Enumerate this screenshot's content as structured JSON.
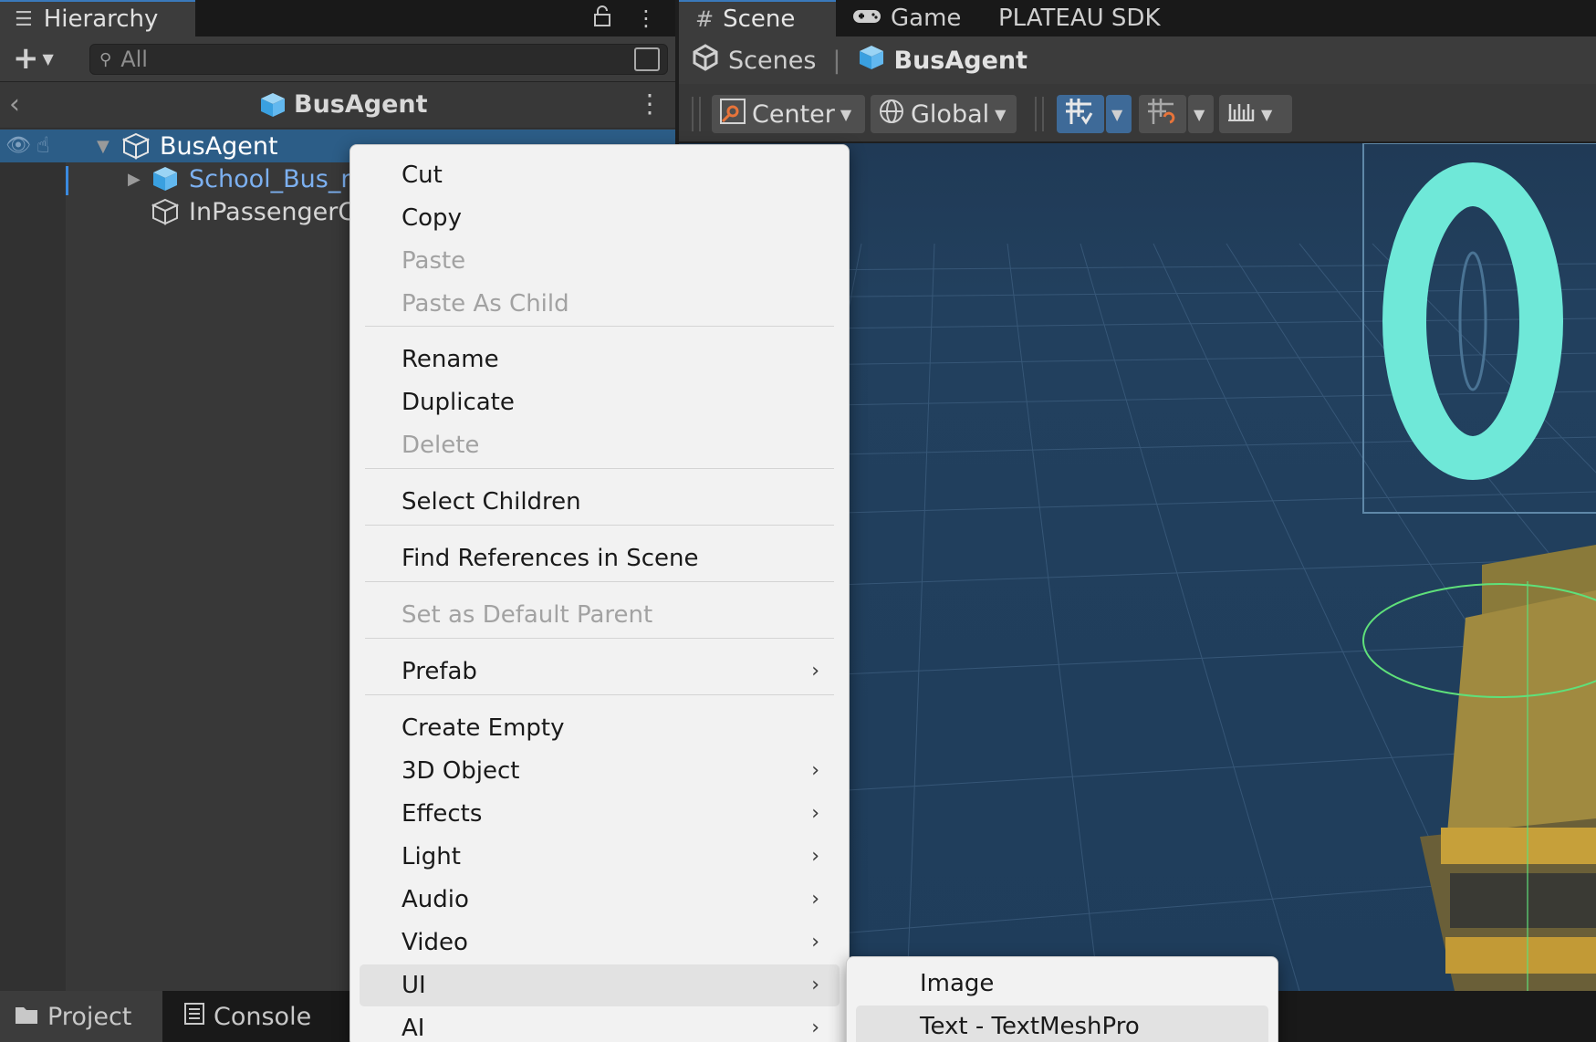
{
  "hierarchy": {
    "tab_label": "Hierarchy",
    "search_placeholder": "All",
    "breadcrumb": "BusAgent",
    "tree": [
      {
        "label": "BusAgent",
        "kind": "root"
      },
      {
        "label": "School_Bus_n",
        "kind": "prefab"
      },
      {
        "label": "InPassengerC",
        "kind": "object"
      }
    ]
  },
  "bottom_tabs": [
    "Project",
    "Console"
  ],
  "scene": {
    "tabs": [
      "Scene",
      "Game",
      "PLATEAU SDK"
    ],
    "breadcrumb_root": "Scenes",
    "breadcrumb_current": "BusAgent",
    "toolbar": {
      "pivot": "Center",
      "space": "Global"
    },
    "viewport_text": "0"
  },
  "context_menu": {
    "items": [
      {
        "label": "Cut",
        "disabled": false
      },
      {
        "label": "Copy",
        "disabled": false
      },
      {
        "label": "Paste",
        "disabled": true
      },
      {
        "label": "Paste As Child",
        "disabled": true
      },
      {
        "label": "Rename",
        "disabled": false
      },
      {
        "label": "Duplicate",
        "disabled": false
      },
      {
        "label": "Delete",
        "disabled": true
      },
      {
        "label": "Select Children",
        "disabled": false
      },
      {
        "label": "Find References in Scene",
        "disabled": false
      },
      {
        "label": "Set as Default Parent",
        "disabled": true
      },
      {
        "label": "Prefab",
        "disabled": false,
        "submenu": true
      },
      {
        "label": "Create Empty",
        "disabled": false
      },
      {
        "label": "3D Object",
        "disabled": false,
        "submenu": true
      },
      {
        "label": "Effects",
        "disabled": false,
        "submenu": true
      },
      {
        "label": "Light",
        "disabled": false,
        "submenu": true
      },
      {
        "label": "Audio",
        "disabled": false,
        "submenu": true
      },
      {
        "label": "Video",
        "disabled": false,
        "submenu": true
      },
      {
        "label": "UI",
        "disabled": false,
        "submenu": true,
        "hovered": true
      },
      {
        "label": "AI",
        "disabled": false,
        "submenu": true
      }
    ],
    "ui_submenu": [
      {
        "label": "Image"
      },
      {
        "label": "Text - TextMeshPro",
        "hovered": true
      }
    ]
  },
  "colors": {
    "selection": "#2c5d87",
    "prefab_text": "#7cb0f0",
    "accent_tab": "#3a79bb",
    "viewport_bg": "#1f3d5c",
    "menu_bg": "#f2f2f2",
    "cyan_glyph": "#6fe8d8"
  }
}
